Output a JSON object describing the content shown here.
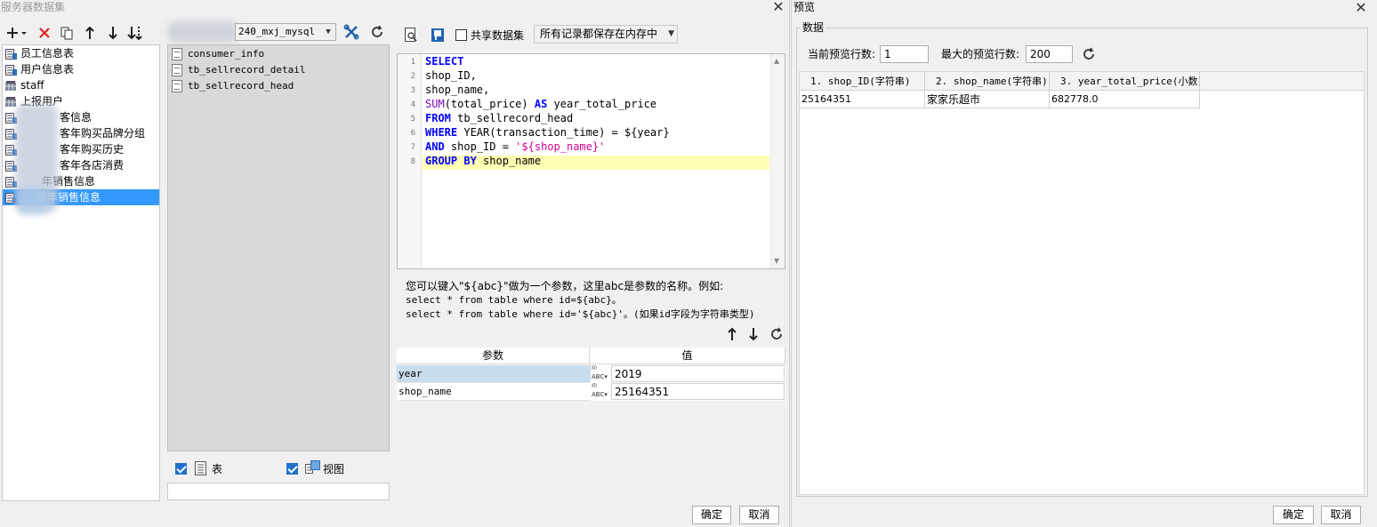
{
  "left_dialog": {
    "title": "服务器数据集",
    "datasets": [
      {
        "label": "员工信息表"
      },
      {
        "label": "用户信息表"
      },
      {
        "label": "staff"
      },
      {
        "label": "上报用户"
      },
      {
        "label": "客信息"
      },
      {
        "label": "客年购买品牌分组"
      },
      {
        "label": "客年购买历史"
      },
      {
        "label": "客年各店消费"
      },
      {
        "label": "年销售信息"
      },
      {
        "label": "店年销售信息"
      }
    ],
    "connection": "240_mxj_mysql",
    "tables": [
      "consumer_info",
      "tb_sellrecord_detail",
      "tb_sellrecord_head"
    ],
    "show_table_label": "表",
    "show_view_label": "视图",
    "share_dataset_label": "共享数据集",
    "cache_mode": "所有记录都保存在内存中",
    "sql_lines": [
      "1",
      "2",
      "3",
      "4",
      "5",
      "6",
      "7",
      "8"
    ],
    "sql": {
      "l1_kw": "SELECT",
      "l2": "shop_ID,",
      "l3": "shop_name,",
      "l4_fn": "SUM",
      "l4_a": "(total_price) ",
      "l4_kw": "AS",
      "l4_b": " year_total_price",
      "l5_kw": "FROM",
      "l5_b": " tb_sellrecord_head",
      "l6_kw": "WHERE",
      "l6_fn": " YEAR",
      "l6_b": "(transaction_time) = ${year}",
      "l7_kw": "AND",
      "l7_b": " shop_ID = ",
      "l7_str": "'${shop_name}'",
      "l8_kw1": "GROUP",
      "l8_kw2": "BY",
      "l8_b": " shop_name"
    },
    "hint": {
      "line1": "您可以键入\"${abc}\"做为一个参数，这里abc是参数的名称。例如:",
      "line2": "select * from table where id=${abc}。",
      "line3": "select * from table where id='${abc}'。(如果id字段为字符串类型)"
    },
    "param_header": {
      "name": "参数",
      "value": "值"
    },
    "params": [
      {
        "name": "year",
        "type": "ABC",
        "value": "2019"
      },
      {
        "name": "shop_name",
        "type": "ABC",
        "value": "25164351"
      }
    ],
    "ok_label": "确定",
    "cancel_label": "取消"
  },
  "right_dialog": {
    "title": "预览",
    "group_label": "数据",
    "current_rows_label": "当前预览行数:",
    "current_rows_value": "1",
    "max_rows_label": "最大的预览行数:",
    "max_rows_value": "200",
    "columns": [
      "1. shop_ID(字符串)",
      "2. shop_name(字符串)",
      "3. year_total_price(小数)"
    ],
    "rows": [
      [
        "25164351",
        "家家乐超市",
        "682778.0"
      ]
    ],
    "ok_label": "确定",
    "cancel_label": "取消"
  }
}
